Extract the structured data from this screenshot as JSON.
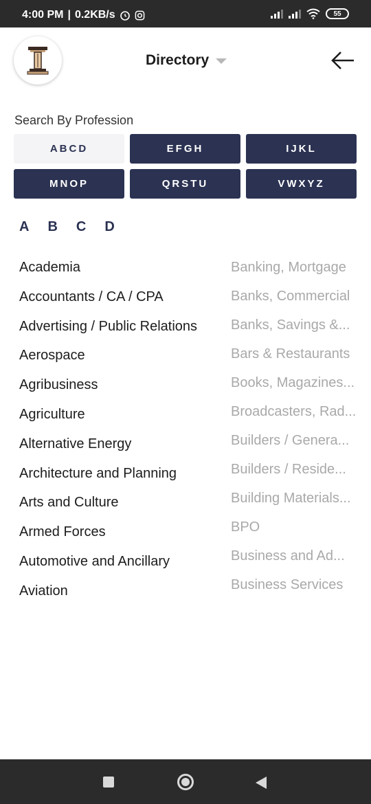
{
  "status_bar": {
    "time": "4:00 PM",
    "net_speed": "0.2KB/s",
    "battery": "55",
    "icons": [
      "alarm-icon",
      "instagram-icon",
      "signal-icon",
      "signal-icon",
      "wifi-icon",
      "battery-icon"
    ]
  },
  "header": {
    "title": "Directory",
    "logo_icon": "pillar-logo-icon",
    "back_icon": "arrow-left-icon"
  },
  "search": {
    "label": "Search By Profession",
    "groups": [
      {
        "label": "ABCD",
        "active": true
      },
      {
        "label": "EFGH",
        "active": false
      },
      {
        "label": "IJKL",
        "active": false
      },
      {
        "label": "MNOP",
        "active": false
      },
      {
        "label": "QRSTU",
        "active": false
      },
      {
        "label": "VWXYZ",
        "active": false
      }
    ],
    "letters": [
      "A",
      "B",
      "C",
      "D"
    ]
  },
  "professions_left": [
    "Academia",
    "Accountants / CA / CPA",
    "Advertising / Public Relations",
    "Aerospace",
    "Agribusiness",
    "Agriculture",
    "Alternative Energy",
    "Architecture and Planning",
    "Arts and Culture",
    "Armed Forces",
    "Automotive and Ancillary",
    "Aviation"
  ],
  "professions_right": [
    "Banking, Mortgage",
    "Banks, Commercial",
    "Banks, Savings &...",
    "Bars & Restaurants",
    "Books, Magazines...",
    "Broadcasters, Rad...",
    "Builders / Genera...",
    "Builders / Reside...",
    "Building Materials...",
    "BPO",
    "Business and Ad...",
    "Business Services"
  ],
  "colors": {
    "accent": "#2b3252",
    "muted_text": "#a9a9a9",
    "system_bar": "#2b2b2b"
  }
}
